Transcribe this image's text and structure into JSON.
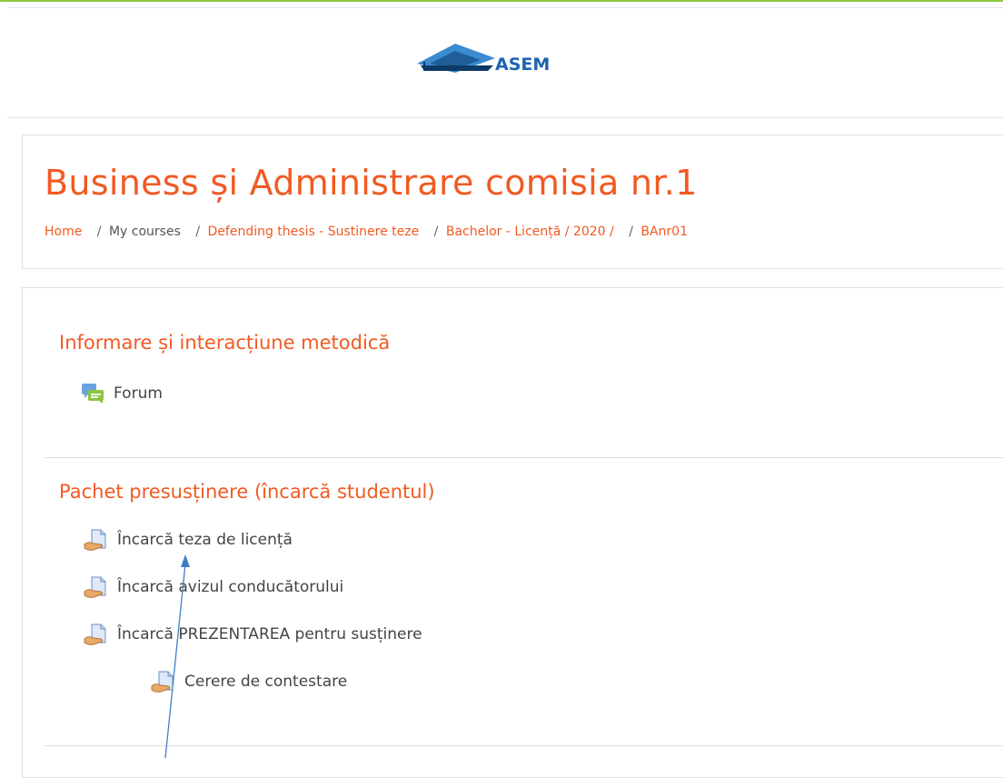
{
  "site": {
    "logo_icon": "asem-logo-icon",
    "logo_text": "ASEM",
    "accent": "#f15a22",
    "topline_color": "#8cc63f"
  },
  "header": {
    "title": "Business și Administrare comisia nr.1",
    "breadcrumb": [
      "Home",
      "My courses",
      "Defending thesis - Sustinere teze",
      "Bachelor - Licență / 2020 /",
      "BAnr01"
    ]
  },
  "sections": [
    {
      "title": "Informare și interacțiune metodică",
      "activities": [
        {
          "label": "Forum",
          "icon": "forum-icon"
        }
      ]
    },
    {
      "title": "Pachet presusținere (încarcă studentul)",
      "activities": [
        {
          "label": "Încarcă teza de licență",
          "icon": "assignment-icon"
        },
        {
          "label": "Încarcă avizul conducătorului",
          "icon": "assignment-icon"
        },
        {
          "label": "Încarcă PREZENTAREA pentru susținere",
          "icon": "assignment-icon"
        },
        {
          "label": "Cerere de contestare",
          "icon": "assignment-icon"
        }
      ]
    }
  ]
}
